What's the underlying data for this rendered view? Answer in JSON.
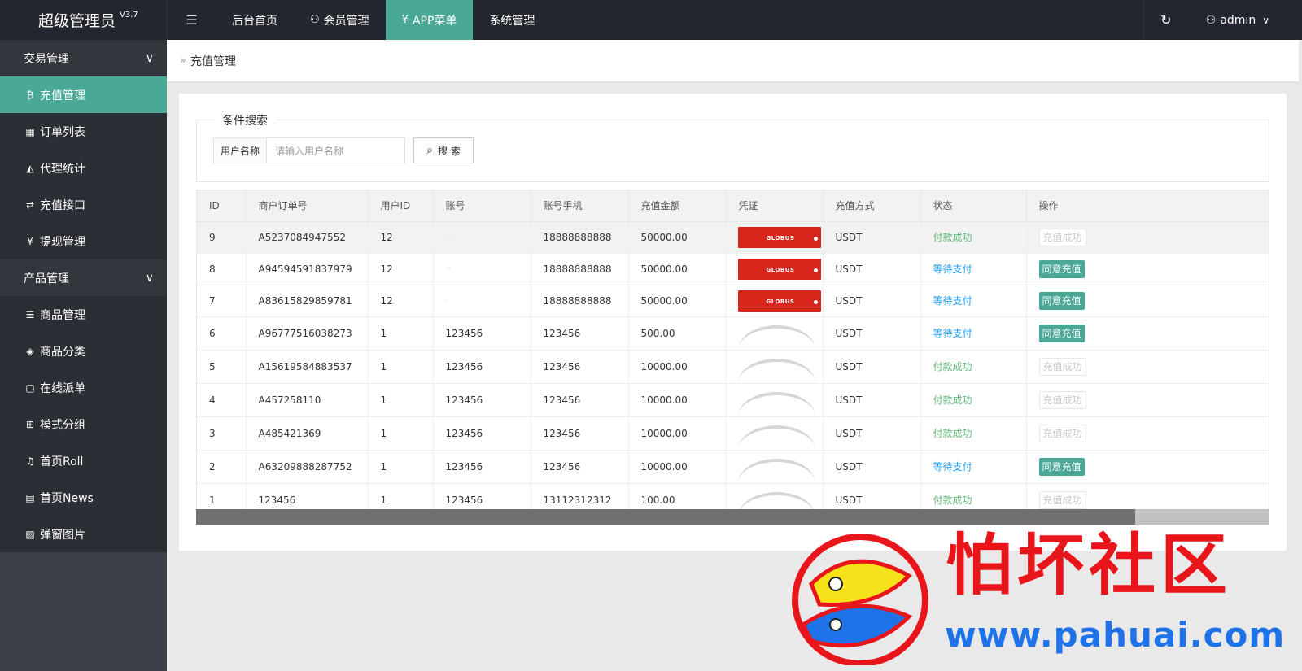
{
  "app": {
    "title": "超级管理员",
    "version": "V3.7"
  },
  "topnav": [
    {
      "label": "后台首页",
      "icon": ""
    },
    {
      "label": "会员管理",
      "icon": "user-icon"
    },
    {
      "label": "APP菜单",
      "icon": "yen-icon",
      "active": true
    },
    {
      "label": "系统管理",
      "icon": ""
    }
  ],
  "user": {
    "name": "admin"
  },
  "sidebar": {
    "groups": [
      {
        "label": "交易管理",
        "items": [
          {
            "label": "充值管理",
            "icon": "bitcoin-icon",
            "glyph": "₿",
            "active": true
          },
          {
            "label": "订单列表",
            "icon": "calendar-icon",
            "glyph": "▦"
          },
          {
            "label": "代理统计",
            "icon": "area-chart-icon",
            "glyph": "◭"
          },
          {
            "label": "充值接口",
            "icon": "exchange-icon",
            "glyph": "⇄"
          },
          {
            "label": "提现管理",
            "icon": "yen-icon",
            "glyph": "¥"
          }
        ]
      },
      {
        "label": "产品管理",
        "items": [
          {
            "label": "商品管理",
            "icon": "list-icon",
            "glyph": "☰"
          },
          {
            "label": "商品分类",
            "icon": "layers-icon",
            "glyph": "◈"
          },
          {
            "label": "在线派单",
            "icon": "note-icon",
            "glyph": "▢"
          },
          {
            "label": "模式分组",
            "icon": "sitemap-icon",
            "glyph": "⊞"
          },
          {
            "label": "首页Roll",
            "icon": "bell-icon",
            "glyph": "♫"
          },
          {
            "label": "首页News",
            "icon": "clipboard-icon",
            "glyph": "▤"
          },
          {
            "label": "弹窗图片",
            "icon": "image-icon",
            "glyph": "▨"
          }
        ]
      }
    ]
  },
  "breadcrumb": {
    "title": "充值管理"
  },
  "search": {
    "legend": "条件搜索",
    "label": "用户名称",
    "placeholder": "请输入用户名称",
    "button": "搜 索"
  },
  "table": {
    "headers": [
      "ID",
      "商户订单号",
      "用户ID",
      "账号",
      "账号手机",
      "充值金额",
      "凭证",
      "充值方式",
      "状态",
      "操作"
    ],
    "rows": [
      {
        "id": "9",
        "order": "A5237084947552",
        "uid": "12",
        "account": "··",
        "phone": "18888888888",
        "amount": "50000.00",
        "voucher": "image",
        "method": "USDT",
        "status": "付款成功",
        "status_type": "ok",
        "action": "充值成功",
        "action_type": "done"
      },
      {
        "id": "8",
        "order": "A94594591837979",
        "uid": "12",
        "account": "··",
        "phone": "18888888888",
        "amount": "50000.00",
        "voucher": "image",
        "method": "USDT",
        "status": "等待支付",
        "status_type": "wait",
        "action": "同意充值",
        "action_type": "agree"
      },
      {
        "id": "7",
        "order": "A83615829859781",
        "uid": "12",
        "account": "·",
        "phone": "18888888888",
        "amount": "50000.00",
        "voucher": "image",
        "method": "USDT",
        "status": "等待支付",
        "status_type": "wait",
        "action": "同意充值",
        "action_type": "agree"
      },
      {
        "id": "6",
        "order": "A96777516038273",
        "uid": "1",
        "account": "123456",
        "phone": "123456",
        "amount": "500.00",
        "voucher": "arc",
        "method": "USDT",
        "status": "等待支付",
        "status_type": "wait",
        "action": "同意充值",
        "action_type": "agree"
      },
      {
        "id": "5",
        "order": "A15619584883537",
        "uid": "1",
        "account": "123456",
        "phone": "123456",
        "amount": "10000.00",
        "voucher": "arc",
        "method": "USDT",
        "status": "付款成功",
        "status_type": "ok",
        "action": "充值成功",
        "action_type": "done"
      },
      {
        "id": "4",
        "order": "A457258110",
        "uid": "1",
        "account": "123456",
        "phone": "123456",
        "amount": "10000.00",
        "voucher": "arc",
        "method": "USDT",
        "status": "付款成功",
        "status_type": "ok",
        "action": "充值成功",
        "action_type": "done"
      },
      {
        "id": "3",
        "order": "A485421369",
        "uid": "1",
        "account": "123456",
        "phone": "123456",
        "amount": "10000.00",
        "voucher": "arc",
        "method": "USDT",
        "status": "付款成功",
        "status_type": "ok",
        "action": "充值成功",
        "action_type": "done"
      },
      {
        "id": "2",
        "order": "A63209888287752",
        "uid": "1",
        "account": "123456",
        "phone": "123456",
        "amount": "10000.00",
        "voucher": "arc",
        "method": "USDT",
        "status": "等待支付",
        "status_type": "wait",
        "action": "同意充值",
        "action_type": "agree"
      },
      {
        "id": "1",
        "order": "123456",
        "uid": "1",
        "account": "123456",
        "phone": "13112312312",
        "amount": "100.00",
        "voucher": "arc",
        "method": "USDT",
        "status": "付款成功",
        "status_type": "ok",
        "action": "充值成功",
        "action_type": "done"
      }
    ],
    "voucher_image_text": "GLOBUS"
  },
  "watermark": {
    "text": "怕坏社区",
    "url": "www.pahuai.com"
  },
  "colors": {
    "accent": "#4aa896",
    "topbar": "#23262e",
    "sidebar": "#3c3f47",
    "status_ok": "#5fb878",
    "status_wait": "#1e9fff"
  }
}
